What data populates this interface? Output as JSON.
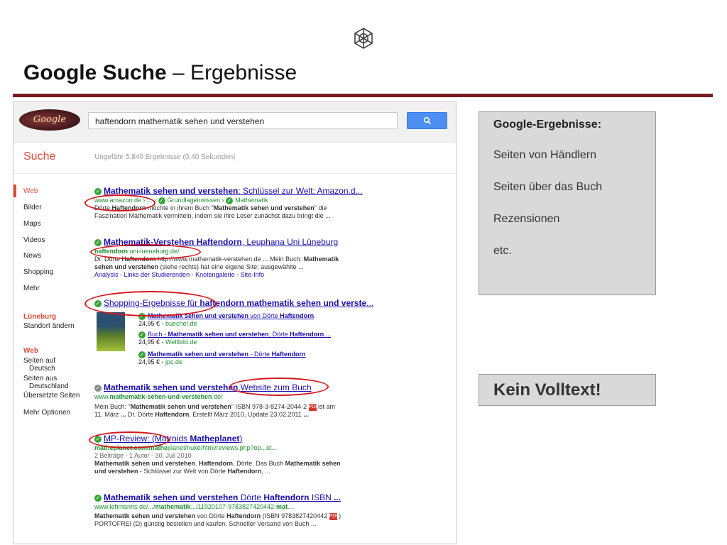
{
  "slide": {
    "title_bold": "Google Suche",
    "title_rest": " – Ergebnisse"
  },
  "google": {
    "doodle_text": "Google",
    "query": "haftendorn mathematik sehen und verstehen",
    "search_button_icon": "search-icon",
    "suche_label": "Suche",
    "stats": "Ungefähr 5.840 Ergebnisse (0,40 Sekunden)",
    "nav_items": [
      "Web",
      "Bilder",
      "Maps",
      "Videos",
      "News",
      "Shopping",
      "Mehr"
    ],
    "location_head": "Lüneburg",
    "location_change": "Standort ändern",
    "web_head": "Web",
    "web_options": [
      "Seiten auf",
      "Deutsch",
      "Seiten aus",
      "Deutschland",
      "Übersetzte Seiten"
    ],
    "more_options": "Mehr Optionen"
  },
  "results": [
    {
      "title_bold": "Mathematik sehen und verstehen",
      "title_rest": ": Schlüssel zur Welt: Amazon.d...",
      "url": "www.amazon.de › ... › ",
      "breadcrumb1": "Grundlagenwissen",
      "breadcrumb_sep": " › ",
      "breadcrumb2": "Mathematik",
      "snippet_1a": "Dörte ",
      "snippet_1b": "Haftendorn",
      "snippet_1c": " möchte in ihrem Buch \"",
      "snippet_1d": "Mathematik sehen und verstehen",
      "snippet_1e": "\" die",
      "snippet_2": "Faszination Mathematik vermitteln, indem sie ihre Leser zunächst dazu bringt die ..."
    },
    {
      "title_bold": "Mathematik-Verstehen Haftendorn",
      "title_rest": ", Leuphana Uni Lüneburg",
      "url_bold": "haftendorn",
      "url_rest": ".uni-lueneburg.de/",
      "snippet_1a": "Dr. Dörte ",
      "snippet_1b": "Haftendorn",
      "snippet_1c": " http://www.mathematik-verstehen.de ... Mein Buch: ",
      "snippet_1d": "Mathematik",
      "snippet_2a": "sehen und verstehen",
      "snippet_2b": " (siehe rechts) hat eine eigene Site; ausgewählte ...",
      "sitelinks": "Analysis - Links der Studierenden - Knotengalerie - Site-Info"
    },
    {
      "title_a": "Shopping-Ergebnisse für ",
      "title_bold": "haftendorn mathematik sehen und verste",
      "title_rest": "...",
      "items": [
        {
          "title_bold": "Mathematik sehen und verstehen",
          "title_rest": " von Dörte ",
          "title_bold2": "Haftendorn",
          "price": "24,95 € - ",
          "shop": "buecher.de"
        },
        {
          "title_a": "Buch - ",
          "title_bold": "Mathematik sehen und verstehen",
          "title_rest": ", Dörte ",
          "title_bold2": "Haftendorn",
          "title_end": " ...",
          "price": "24,95 € - ",
          "shop": "Weltbild.de"
        },
        {
          "title_bold": "Mathematik sehen und verstehen",
          "title_rest": " - Dörte ",
          "title_bold2": "Haftendorn",
          "price": "24,95 € - ",
          "shop": "jpc.de"
        }
      ]
    },
    {
      "title_bold": "Mathematik sehen und verstehen",
      "title_rest": ",Website zum Buch",
      "url_a": "www.",
      "url_bold": "mathematik-sehen-und-verstehen",
      "url_rest": ".de/",
      "snippet_1a": "Mein Buch: \"",
      "snippet_1b": "Mathematik sehen und verstehen",
      "snippet_1c": "\" ISBN 978-3-8274-2044-2 ",
      "snippet_1d": " ist am",
      "snippet_2a": "11. März ",
      "snippet_2b": "...",
      "snippet_2c": " Dr. Dörte ",
      "snippet_2d": "Haftendorn",
      "snippet_2e": ", Erstellt März 2010, Update 23.02.2011 ",
      "snippet_2f": "..."
    },
    {
      "title_a": "MP-Review: ",
      "title_b": "(Matroids ",
      "title_bold": "Matheplanet",
      "title_rest": ")",
      "url_bold1": "matheplanet.com/",
      "url_bold2": "mathe",
      "url_rest": "planet/nuke/html/reviews.php?op...id...",
      "meta": "2 Beiträge - 1 Autor - 30. Juli 2010",
      "snippet_1a": "Mathematik sehen und verstehen",
      "snippet_1b": ". ",
      "snippet_1c": "Haftendorn",
      "snippet_1d": ", Dörte. Das Buch ",
      "snippet_1e": "Mathematik sehen",
      "snippet_2a": "und verstehen",
      "snippet_2b": " - Schlüssel zur Welt von Dörte ",
      "snippet_2c": "Haftendorn",
      "snippet_2d": ", ..."
    },
    {
      "title_bold": "Mathematik sehen und verstehen",
      "title_rest": " Dörte ",
      "title_bold2": "Haftendorn",
      "title_end": " ISBN ",
      "title_bold3": "...",
      "url_a": "www.lehmanns.de/.../",
      "url_bold": "mathematik",
      "url_rest": ".../11920107-9783827420442-",
      "url_bold2": "mat",
      "url_end": "...",
      "snippet_1a": "Mathematik sehen und verstehen",
      "snippet_1b": " von Dörte ",
      "snippet_1c": "Haftendorn",
      "snippet_1d": " (ISBN 9783827420442 ",
      "snippet_1e": " )",
      "snippet_2": "PORTOFREI (D) günstig bestellen und kaufen. Schneller Versand von Buch ..."
    }
  ],
  "callouts": {
    "box1_heading": "Google-Ergebnisse:",
    "box1_lines": [
      "Seiten von Händlern",
      "Seiten über das Buch",
      "Rezensionen",
      "etc."
    ],
    "box2_text": "Kein Volltext!"
  },
  "icons": {
    "slide_logo": "network-cube-icon",
    "check": "verified-check-icon",
    "pdf": "pdf-icon"
  },
  "colors": {
    "rule": "#7a1b1f",
    "google_red": "#dd4b39",
    "link_blue": "#1a0dab",
    "url_green": "#1e8f30",
    "annotation_red": "#d4161a",
    "callout_bg": "#d9d9d9",
    "search_blue": "#4d8ff0"
  }
}
